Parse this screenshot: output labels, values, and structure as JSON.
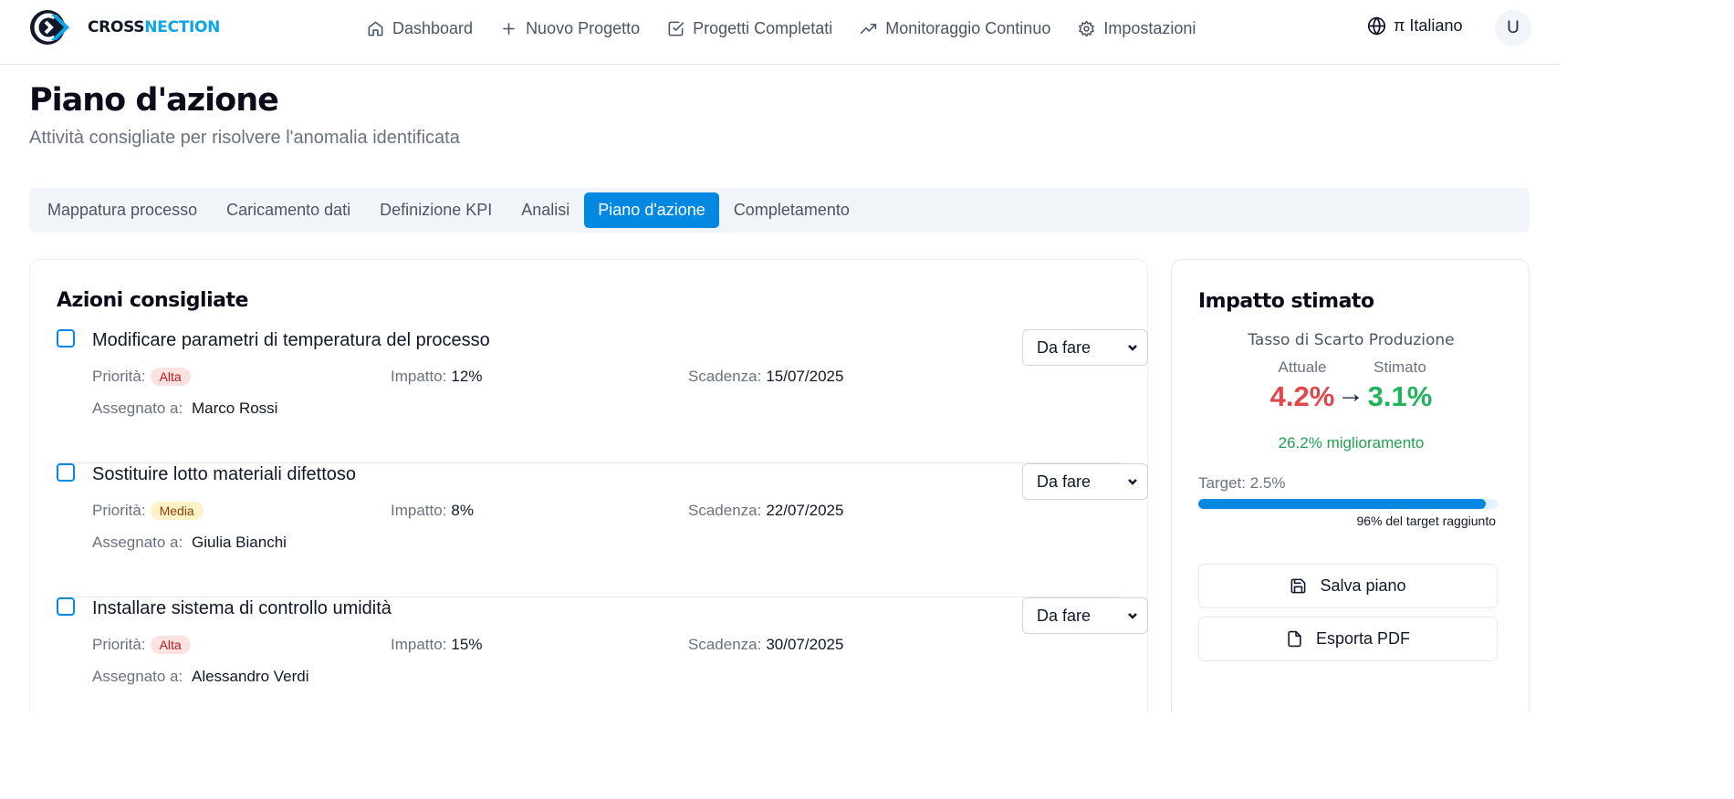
{
  "brand": {
    "part1": "CROSS",
    "part2": "NECTION",
    "accent": "#0ea5e9"
  },
  "nav": [
    {
      "label": "Dashboard",
      "icon": "home-icon"
    },
    {
      "label": "Nuovo Progetto",
      "icon": "plus-icon"
    },
    {
      "label": "Progetti Completati",
      "icon": "check-square-icon"
    },
    {
      "label": "Monitoraggio Continuo",
      "icon": "trending-up-icon"
    },
    {
      "label": "Impostazioni",
      "icon": "gear-icon"
    }
  ],
  "language": {
    "label": "π Italiano",
    "icon": "globe-icon"
  },
  "user": {
    "initial": "U"
  },
  "page": {
    "title": "Piano d'azione",
    "subtitle": "Attività consigliate per risolvere l'anomalia identificata"
  },
  "tabs": [
    {
      "label": "Mappatura processo",
      "active": false
    },
    {
      "label": "Caricamento dati",
      "active": false
    },
    {
      "label": "Definizione KPI",
      "active": false
    },
    {
      "label": "Analisi",
      "active": false
    },
    {
      "label": "Piano d'azione",
      "active": true
    },
    {
      "label": "Completamento",
      "active": false
    }
  ],
  "actions": {
    "title": "Azioni consigliate",
    "labels": {
      "priority": "Priorità:",
      "impact": "Impatto:",
      "due": "Scadenza:",
      "assigned": "Assegnato a:"
    },
    "items": [
      {
        "title": "Modificare parametri di temperatura del processo",
        "priority": "Alta",
        "impact": "12%",
        "due": "15/07/2025",
        "assignee": "Marco Rossi",
        "status": "Da fare"
      },
      {
        "title": "Sostituire lotto materiali difettoso",
        "priority": "Media",
        "impact": "8%",
        "due": "22/07/2025",
        "assignee": "Giulia Bianchi",
        "status": "Da fare"
      },
      {
        "title": "Installare sistema di controllo umidità",
        "priority": "Alta",
        "impact": "15%",
        "due": "30/07/2025",
        "assignee": "Alessandro Verdi",
        "status": "Da fare"
      }
    ]
  },
  "impact": {
    "title": "Impatto stimato",
    "metric": "Tasso di Scarto Produzione",
    "current_label": "Attuale",
    "current_value": "4.2%",
    "arrow": "→",
    "estimated_label": "Stimato",
    "estimated_value": "3.1%",
    "improvement": "26.2% miglioramento",
    "target": "Target: 2.5%",
    "progress_percent": 96,
    "progress_note": "96% del target raggiunto",
    "save_label": "Salva piano",
    "export_label": "Esporta PDF"
  },
  "colors": {
    "primary": "#0288e0",
    "current": "#e0474c",
    "estimated": "#22b35d"
  }
}
